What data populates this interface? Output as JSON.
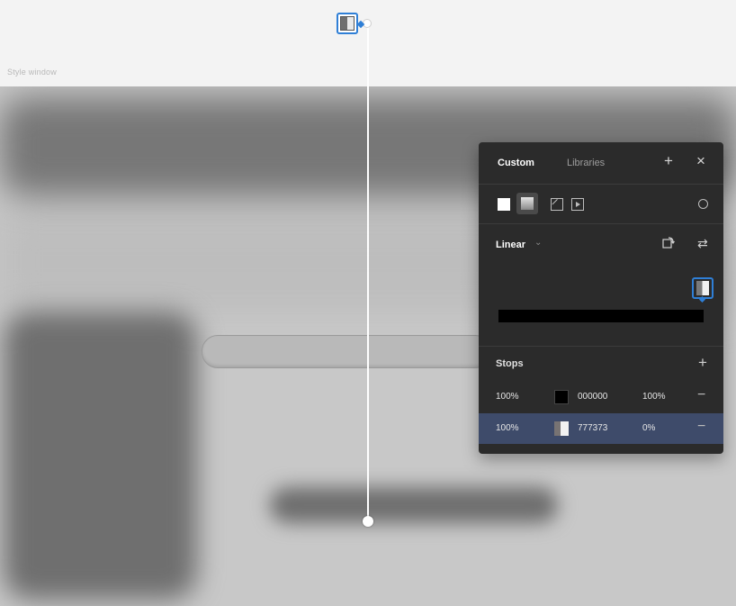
{
  "window": {
    "label": "Style window"
  },
  "panel": {
    "tabs": [
      {
        "label": "Custom",
        "active": true
      },
      {
        "label": "Libraries",
        "active": false
      }
    ],
    "header_icons": [
      "plus-icon",
      "close-icon"
    ],
    "fill_types": [
      "solid-fill-icon",
      "gradient-fill-icon",
      "image-fill-icon",
      "video-fill-icon"
    ],
    "gradient_type": {
      "label": "Linear",
      "caret": "⌄"
    },
    "gradient_bar": {
      "start_color": "#000000",
      "end_color": "#000000"
    },
    "stops": {
      "label": "Stops",
      "add_icon": "+",
      "rows": [
        {
          "position": "100%",
          "color": "#000000",
          "hex": "000000",
          "opacity": "100%",
          "remove": "−",
          "selected": false
        },
        {
          "position": "100%",
          "color": "#777373",
          "hex": "777373",
          "opacity": "0%",
          "remove": "−",
          "selected": true
        }
      ]
    }
  },
  "colors": {
    "accent": "#2f7fd6",
    "panel_bg": "#2b2b2b",
    "selected_row": "#3e4b6a"
  }
}
